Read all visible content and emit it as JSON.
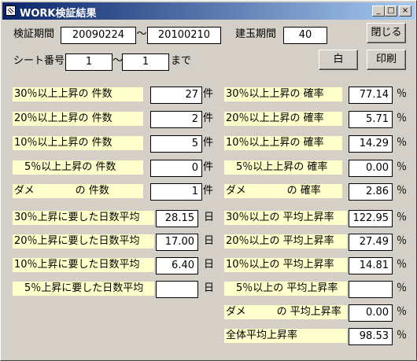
{
  "window": {
    "title": "WORK検証結果",
    "minimize": "_",
    "maximize": "□",
    "close": "×"
  },
  "period": {
    "label": "検証期間",
    "start": "20090224",
    "separator": "～",
    "end": "20100210"
  },
  "holding": {
    "label": "建玉期間",
    "value": "40"
  },
  "sheet": {
    "label": "シート番号",
    "from": "1",
    "separator": "～",
    "to": "1",
    "suffix": "まで"
  },
  "buttons": {
    "close": "閉じる",
    "white": "白",
    "print": "印刷"
  },
  "left_rows": [
    {
      "label": "30％以上上昇の 件数",
      "value": "27",
      "unit": "件"
    },
    {
      "label": "20％以上上昇の 件数",
      "value": "2",
      "unit": "件"
    },
    {
      "label": "10％以上上昇の 件数",
      "value": "5",
      "unit": "件"
    },
    {
      "label": "　5％以上上昇の 件数",
      "value": "0",
      "unit": "件"
    },
    {
      "label": "ダメ　　　　の 件数",
      "value": "1",
      "unit": "件"
    },
    {
      "label": "30％上昇に要した日数平均",
      "value": "28.15",
      "unit": "日"
    },
    {
      "label": "20％上昇に要した日数平均",
      "value": "17.00",
      "unit": "日"
    },
    {
      "label": "10％上昇に要した日数平均",
      "value": "6.40",
      "unit": "日"
    },
    {
      "label": "　5％上昇に要した日数平均",
      "value": "",
      "unit": "日"
    }
  ],
  "right_rows": [
    {
      "label": "30％以上上昇の 確率",
      "value": "77.14",
      "unit": "％"
    },
    {
      "label": "20％以上上昇の 確率",
      "value": "5.71",
      "unit": "％"
    },
    {
      "label": "10％以上上昇の 確率",
      "value": "14.29",
      "unit": "％"
    },
    {
      "label": "　5％以上上昇の 確率",
      "value": "0.00",
      "unit": "％"
    },
    {
      "label": "ダメ　　　　の 確率",
      "value": "2.86",
      "unit": "％"
    },
    {
      "label": "30％以上の 平均上昇率",
      "value": "122.95",
      "unit": "％"
    },
    {
      "label": "20％以上の 平均上昇率",
      "value": "27.49",
      "unit": "％"
    },
    {
      "label": "10％以上の 平均上昇率",
      "value": "14.81",
      "unit": "％"
    },
    {
      "label": "　5％以上の 平均上昇率",
      "value": "",
      "unit": "％"
    },
    {
      "label": "ダメ　　　の 平均上昇率",
      "value": "0.00",
      "unit": "％"
    },
    {
      "label": "全体平均上昇率",
      "value": "98.53",
      "unit": "％"
    }
  ]
}
